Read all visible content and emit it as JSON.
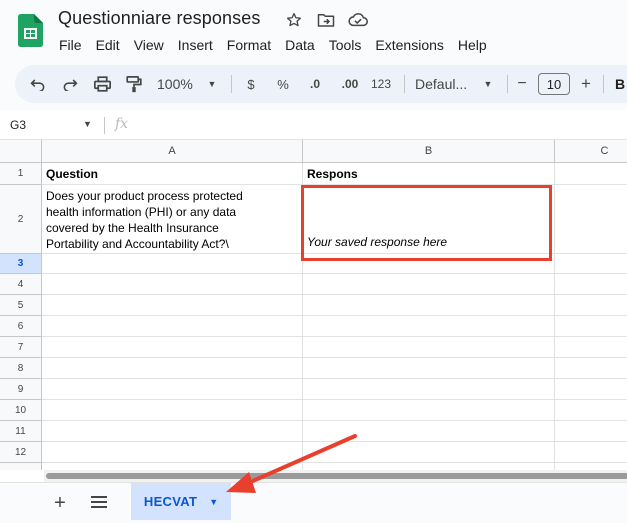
{
  "app": {
    "doc_title": "Questionniare responses",
    "menu": [
      "File",
      "Edit",
      "View",
      "Insert",
      "Format",
      "Data",
      "Tools",
      "Extensions",
      "Help"
    ],
    "title_icons": [
      "star-icon",
      "move-to-folder-icon",
      "cloud-saved-icon"
    ]
  },
  "toolbar": {
    "zoom": "100%",
    "currency": "$",
    "percent": "%",
    "decrease_decimals": ".0",
    "increase_decimals": ".00",
    "number_format": "123",
    "font": "Defaul...",
    "minus": "−",
    "font_size": "10",
    "plus": "+",
    "bold": "B"
  },
  "formula_bar": {
    "name_box": "G3",
    "fx": "fx"
  },
  "grid": {
    "columns": [
      "A",
      "B",
      "C"
    ],
    "rows": [
      "1",
      "2",
      "3",
      "4",
      "5",
      "6",
      "7",
      "8",
      "9",
      "10",
      "11",
      "12"
    ],
    "active_row": "3",
    "cells": {
      "A1": "Question",
      "B1": "Respons",
      "A2_lines": [
        "Does your product process protected",
        "health information (PHI) or any data",
        "covered by the Health Insurance",
        "Portability and Accountability Act?\\"
      ],
      "B2": "Your saved response here"
    }
  },
  "sheets": {
    "active_tab": "HECVAT"
  },
  "colors": {
    "annotation_red": "#e8402d",
    "tab_active_bg": "#d3e3fd",
    "tab_active_text": "#0b57d0"
  }
}
